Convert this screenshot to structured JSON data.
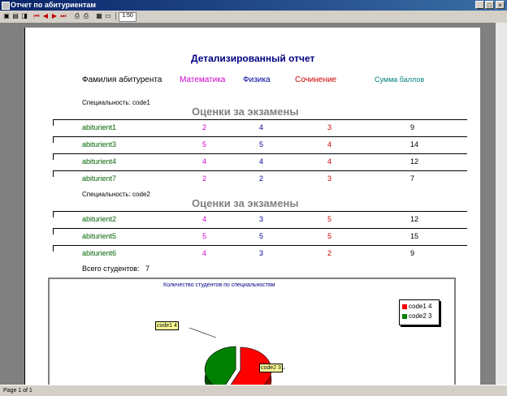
{
  "window": {
    "title": "Отчет по абитуриентам"
  },
  "toolbar": {
    "zoom_label": "1:50"
  },
  "report": {
    "title": "Детализированный отчет",
    "headers": {
      "name": "Фамилия абитурента",
      "math": "Математика",
      "physics": "Физика",
      "essay": "Сочинение",
      "total": "Сумма баллов"
    },
    "section_title": "Оценки за экзамены",
    "groups": [
      {
        "specialty": "Специальность:  code1",
        "rows": [
          {
            "name": "abiturient1",
            "math": "2",
            "physics": "4",
            "essay": "3",
            "total": "9"
          },
          {
            "name": "abiturient3",
            "math": "5",
            "physics": "5",
            "essay": "4",
            "total": "14"
          },
          {
            "name": "abiturient4",
            "math": "4",
            "physics": "4",
            "essay": "4",
            "total": "12"
          },
          {
            "name": "abiturient7",
            "math": "2",
            "physics": "2",
            "essay": "3",
            "total": "7"
          }
        ]
      },
      {
        "specialty": "Специальность:  code2",
        "rows": [
          {
            "name": "abiturient2",
            "math": "4",
            "physics": "3",
            "essay": "5",
            "total": "12"
          },
          {
            "name": "abiturient5",
            "math": "5",
            "physics": "5",
            "essay": "5",
            "total": "15"
          },
          {
            "name": "abiturient6",
            "math": "4",
            "physics": "3",
            "essay": "2",
            "total": "9"
          }
        ]
      }
    ],
    "total_label": "Всего студентов:",
    "total_value": "7"
  },
  "colors": {
    "name": "#006400",
    "math": "#cc00cc",
    "physics": "#000099",
    "essay": "#cc0000",
    "total": "#000000",
    "total_header": "#008080",
    "code1": "#ff0000",
    "code2": "#008000"
  },
  "chart_data": {
    "type": "pie",
    "title": "Количество студентов по специальностям",
    "categories": [
      "code1",
      "code2"
    ],
    "values": [
      4,
      3
    ],
    "legend": [
      "code1 4",
      "code2 3"
    ],
    "labels": [
      "code1 4",
      "code2 3"
    ],
    "legend_position": "top-right"
  },
  "status": {
    "page_label": "Page 1 of 1"
  }
}
